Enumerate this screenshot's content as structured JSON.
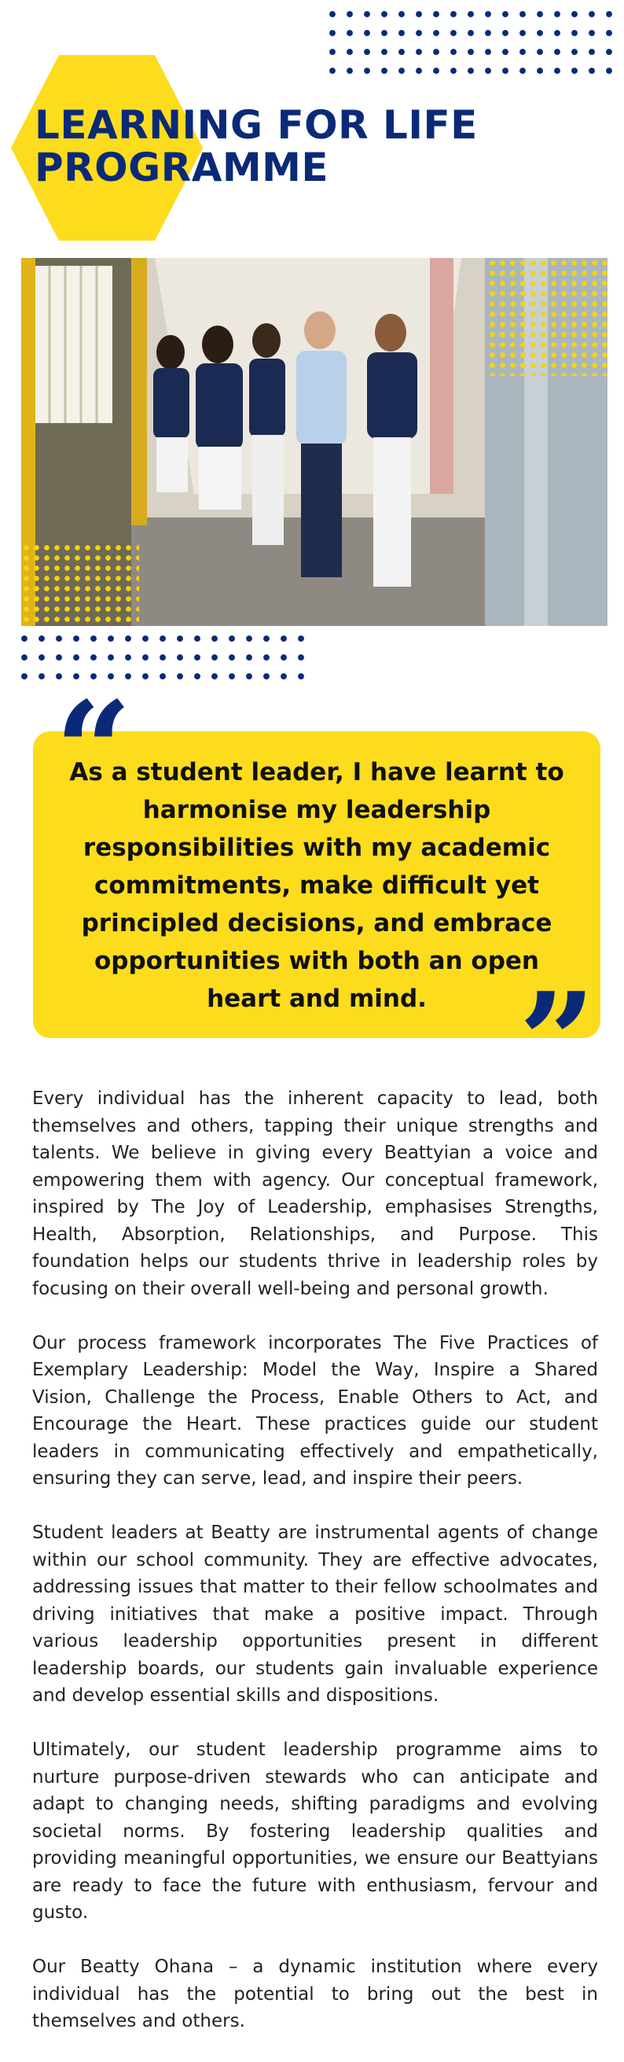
{
  "header": {
    "title": "LEARNING FOR LIFE PROGRAMME"
  },
  "photo": {
    "description_icon": "students-walking-photo"
  },
  "quote": {
    "open_mark": "“",
    "close_mark": "”",
    "text": "As a student leader, I have learnt to harmonise my leadership responsibilities with my academic commitments, make difficult yet principled decisions, and embrace opportunities with both an open heart and mind."
  },
  "body": {
    "paragraphs": [
      "Every individual has the inherent capacity to lead, both themselves and others, tapping their unique strengths and talents. We believe in giving every Beattyian a voice and empowering them with agency. Our conceptual framework, inspired by The Joy of Leadership, emphasises Strengths, Health, Absorption, Relationships, and Purpose. This foundation helps our students thrive in leadership roles by focusing on their overall well-being and personal growth.",
      "Our process framework incorporates The Five Practices of Exemplary Leadership: Model the Way, Inspire a Shared Vision, Challenge the Process, Enable Others to Act, and Encourage the Heart. These practices guide our student leaders in communicating effectively and empathetically, ensuring they can serve, lead, and inspire their peers.",
      "Student leaders at Beatty are instrumental agents of change within our school community. They are effective advocates, addressing issues that matter to their fellow schoolmates and driving initiatives that make a positive impact. Through various leadership opportunities present in different leadership boards, our students gain invaluable experience and develop essential skills and dispositions.",
      "Ultimately, our student leadership programme aims to nurture purpose-driven stewards who can anticipate and adapt to changing needs, shifting paradigms and evolving societal norms. By fostering leadership qualities and providing meaningful opportunities, we ensure our Beattyians are ready to face the future with enthusiasm, fervour and gusto.",
      "Our Beatty Ohana – a dynamic institution where every individual has the potential to bring out the best in themselves and others."
    ]
  },
  "colors": {
    "navy": "#0a2a78",
    "yellow": "#fcdc1c"
  }
}
